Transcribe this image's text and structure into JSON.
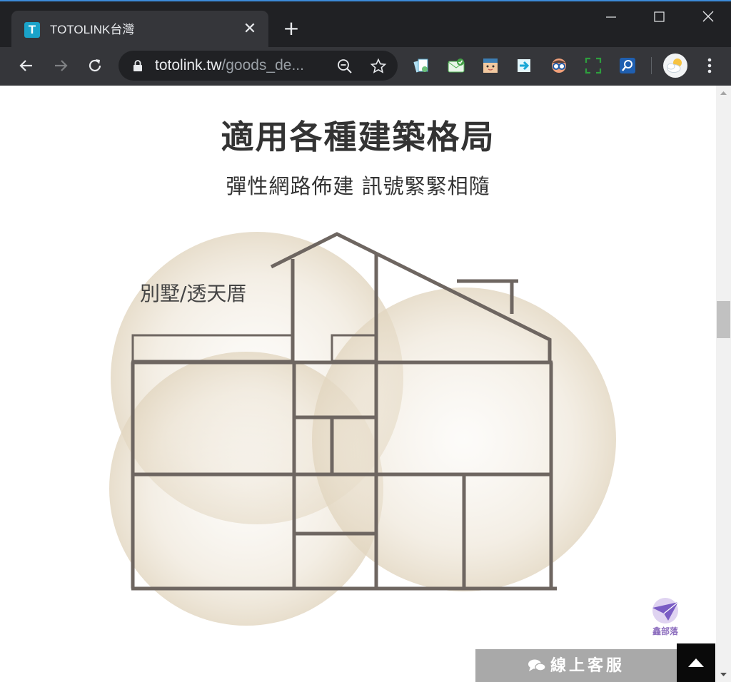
{
  "browser": {
    "tab": {
      "favicon_letter": "T",
      "title": "TOTOLINK台灣",
      "close_glyph": "✕"
    },
    "new_tab_glyph": "+",
    "address_bar": {
      "host": "totolink.tw",
      "path": "/goods_de..."
    },
    "extensions": [
      "bookmark-extension-icon",
      "mail-check-extension-icon",
      "face-extension-icon",
      "share-arrow-extension-icon",
      "glasses-extension-icon",
      "screenshot-extension-icon",
      "search-extension-icon"
    ],
    "profile_icon": "weather-avatar-icon"
  },
  "page": {
    "title": "適用各種建築格局",
    "subtitle": "彈性網路佈建  訊號緊緊相隨",
    "illustration_label": "別墅/透天厝",
    "chat_button": {
      "icon": "chat-bubbles-icon",
      "label": "線上客服"
    },
    "watermark_text": "鑫部落"
  },
  "colors": {
    "tabbar": "#202124",
    "toolbar": "#35363a",
    "house_line": "#6e6661",
    "coverage": "#e6dcc9",
    "chat_button": "#a9a9a9"
  }
}
